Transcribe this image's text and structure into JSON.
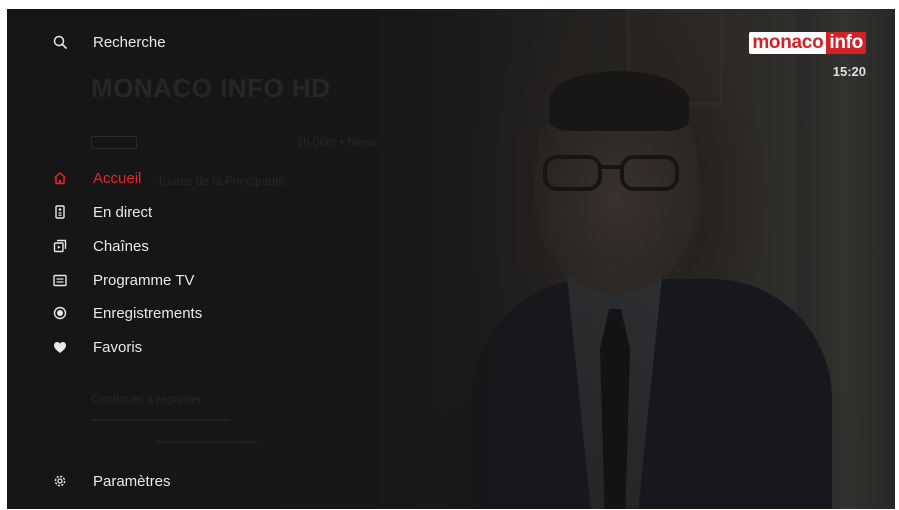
{
  "search": {
    "label": "Recherche"
  },
  "menu": {
    "items": [
      {
        "label": "Accueil",
        "icon": "home-icon",
        "active": true
      },
      {
        "label": "En direct",
        "icon": "remote-icon",
        "active": false
      },
      {
        "label": "Chaînes",
        "icon": "channels-icon",
        "active": false
      },
      {
        "label": "Programme TV",
        "icon": "tv-guide-icon",
        "active": false
      },
      {
        "label": "Enregistrements",
        "icon": "record-icon",
        "active": false
      },
      {
        "label": "Favoris",
        "icon": "heart-icon",
        "active": false
      }
    ],
    "settings_label": "Paramètres"
  },
  "logo": {
    "part1": "monaco",
    "part2": "info"
  },
  "clock": "15:20",
  "background_program": {
    "title": "MONACO INFO HD",
    "duration": "1h 00m",
    "genre": "News",
    "description": "Toutes de la Principauté",
    "section": "Continuer à regarder"
  },
  "colors": {
    "accent": "#e8242a",
    "text": "#e8e8e8",
    "background": "#161616"
  }
}
